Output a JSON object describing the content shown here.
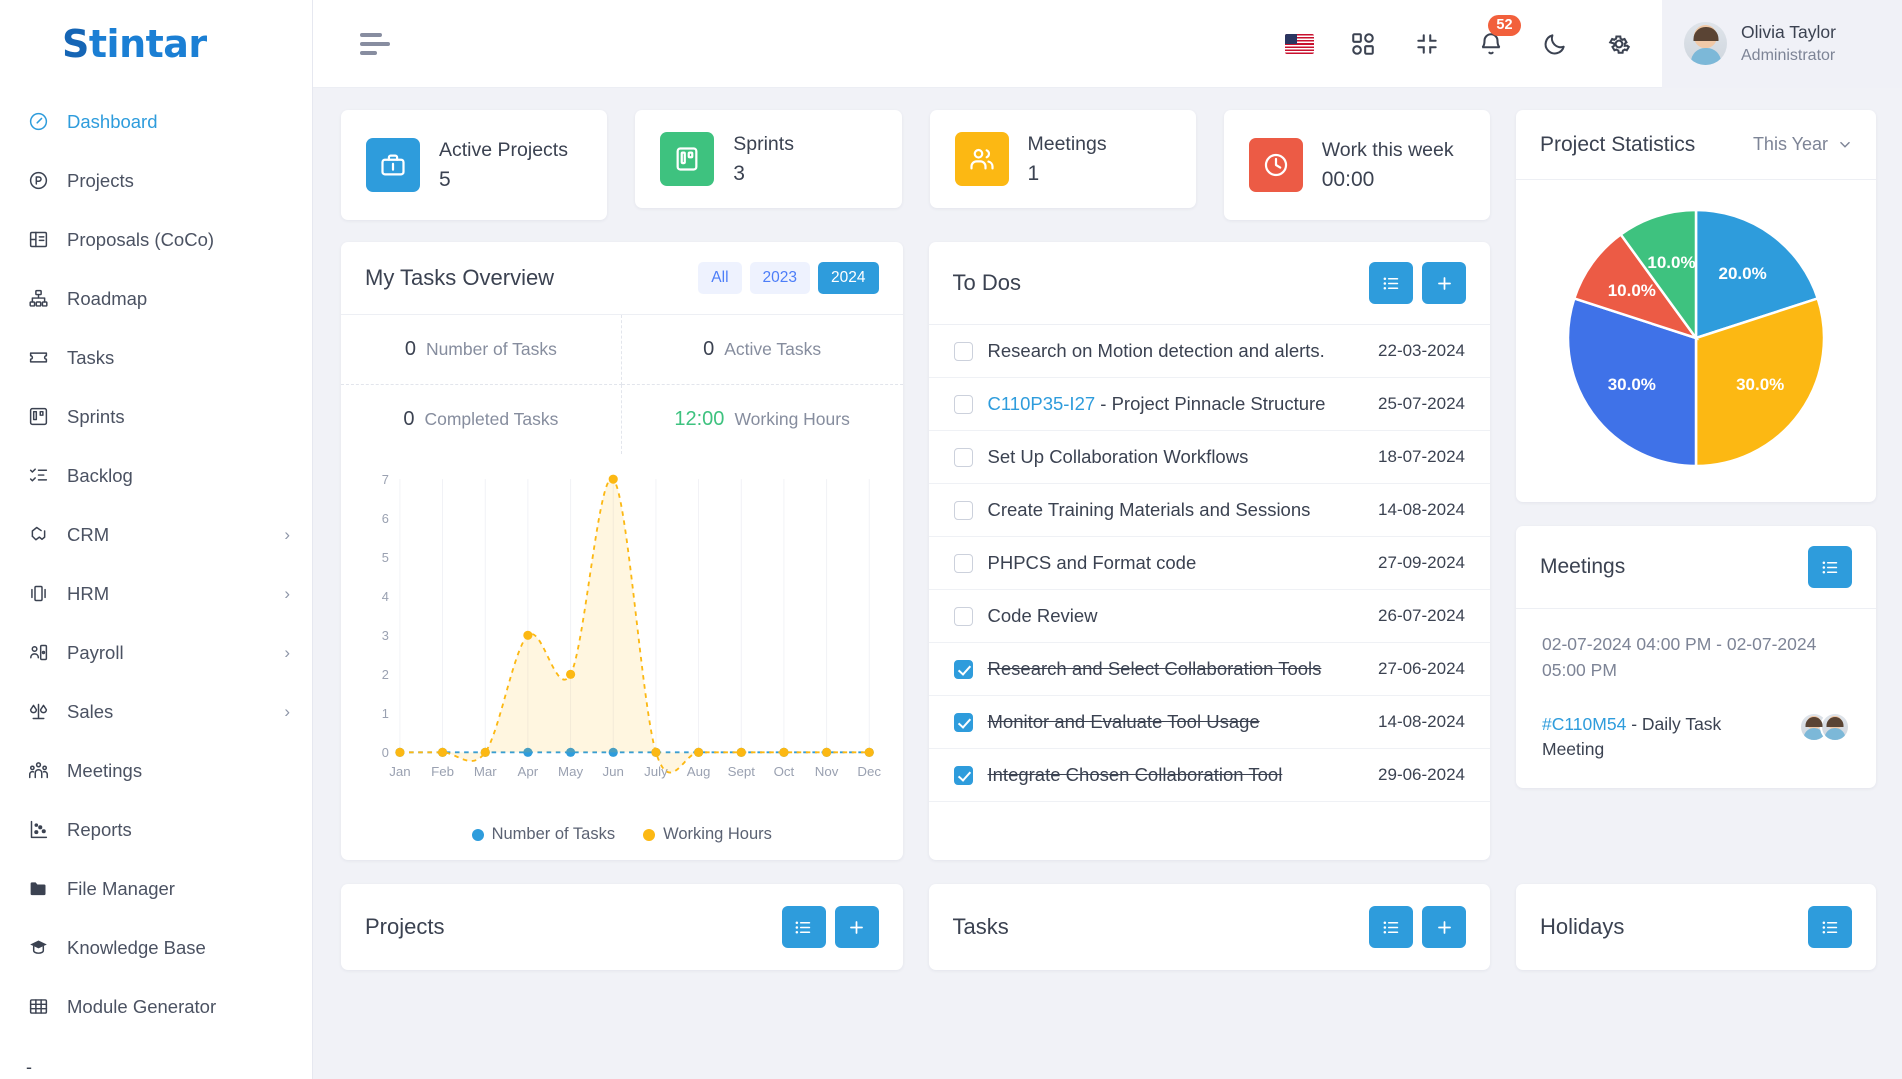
{
  "brand": {
    "name": "Stintar",
    "initial": "S",
    "rest": "tintar"
  },
  "colors": {
    "primary": "#2e9cdc",
    "sidebar_active": "#2e9cdc",
    "badge": "#f2603c",
    "green": "#3ec27f",
    "yellow": "#fcb813",
    "red": "#ec5b45",
    "royal_blue": "#3f72e8"
  },
  "sidebar": {
    "items": [
      {
        "label": "Dashboard",
        "icon": "speedometer-icon",
        "active": true,
        "chevron": false
      },
      {
        "label": "Projects",
        "icon": "circle-p-icon",
        "active": false,
        "chevron": false
      },
      {
        "label": "Proposals (CoCo)",
        "icon": "layout-panel-icon",
        "active": false,
        "chevron": false
      },
      {
        "label": "Roadmap",
        "icon": "hierarchy-icon",
        "active": false,
        "chevron": false
      },
      {
        "label": "Tasks",
        "icon": "ticket-icon",
        "active": false,
        "chevron": false
      },
      {
        "label": "Sprints",
        "icon": "kanban-board-icon",
        "active": false,
        "chevron": false
      },
      {
        "label": "Backlog",
        "icon": "checklist-icon",
        "active": false,
        "chevron": false
      },
      {
        "label": "CRM",
        "icon": "handshake-icon",
        "active": false,
        "chevron": true
      },
      {
        "label": "HRM",
        "icon": "carousel-icon",
        "active": false,
        "chevron": true
      },
      {
        "label": "Payroll",
        "icon": "user-card-icon",
        "active": false,
        "chevron": true
      },
      {
        "label": "Sales",
        "icon": "scales-icon",
        "active": false,
        "chevron": true
      },
      {
        "label": "Meetings",
        "icon": "people-group-icon",
        "active": false,
        "chevron": false
      },
      {
        "label": "Reports",
        "icon": "scatter-chart-icon",
        "active": false,
        "chevron": false
      },
      {
        "label": "File Manager",
        "icon": "folder-icon",
        "active": false,
        "chevron": false
      },
      {
        "label": "Knowledge Base",
        "icon": "graduation-cap-icon",
        "active": false,
        "chevron": false
      },
      {
        "label": "Module Generator",
        "icon": "grid-table-icon",
        "active": false,
        "chevron": false
      }
    ],
    "tail": "-"
  },
  "topbar": {
    "menu_toggle": "hamburger-menu-icon",
    "icons": [
      {
        "name": "flag-us-icon"
      },
      {
        "name": "apps-grid-icon"
      },
      {
        "name": "collapse-fullscreen-icon"
      },
      {
        "name": "notification-bell-icon",
        "badge": "52"
      },
      {
        "name": "dark-mode-moon-icon"
      },
      {
        "name": "settings-gear-icon"
      }
    ],
    "profile": {
      "name": "Olivia Taylor",
      "role": "Administrator",
      "avatar": "user-avatar"
    }
  },
  "stats": [
    {
      "title": "Active Projects",
      "value": "5",
      "icon": "briefcase-icon",
      "color": "#2e9cdc"
    },
    {
      "title": "Sprints",
      "value": "3",
      "icon": "board-icon",
      "color": "#3ec27f"
    },
    {
      "title": "Meetings",
      "value": "1",
      "icon": "users-icon",
      "color": "#fcb813"
    },
    {
      "title": "Work this week",
      "value": "00:00",
      "icon": "clock-icon",
      "color": "#ec5b45"
    }
  ],
  "tasks_overview": {
    "title": "My Tasks Overview",
    "filters": [
      {
        "label": "All",
        "active": false
      },
      {
        "label": "2023",
        "active": false
      },
      {
        "label": "2024",
        "active": true
      }
    ],
    "cells": [
      {
        "value": "0",
        "label": "Number of Tasks",
        "green": false
      },
      {
        "value": "0",
        "label": "Active Tasks",
        "green": false
      },
      {
        "value": "0",
        "label": "Completed Tasks",
        "green": false
      },
      {
        "value": "12:00",
        "label": "Working Hours",
        "green": true
      }
    ]
  },
  "chart_data": {
    "type": "area",
    "title": "My Tasks Overview",
    "xlabel": "",
    "ylabel": "",
    "ylim": [
      0,
      7
    ],
    "yticks": [
      0,
      1,
      2,
      3,
      4,
      5,
      6,
      7
    ],
    "grid": true,
    "legend_position": "bottom",
    "categories": [
      "Jan",
      "Feb",
      "Mar",
      "Apr",
      "May",
      "Jun",
      "July",
      "Aug",
      "Sept",
      "Oct",
      "Nov",
      "Dec"
    ],
    "series": [
      {
        "name": "Number of Tasks",
        "color": "#2e9cdc",
        "values": [
          0,
          0,
          0,
          0,
          0,
          0,
          0,
          0,
          0,
          0,
          0,
          0
        ]
      },
      {
        "name": "Working Hours",
        "color": "#fcb813",
        "values": [
          0,
          0,
          0,
          3,
          2,
          7,
          0,
          0,
          0,
          0,
          0,
          0
        ]
      }
    ]
  },
  "project_statistics": {
    "title": "Project Statistics",
    "range": "This Year",
    "chart": {
      "type": "pie",
      "values": [
        20.0,
        30.0,
        30.0,
        10.0,
        10.0
      ],
      "labels": [
        "20.0%",
        "30.0%",
        "30.0%",
        "10.0%",
        "10.0%"
      ],
      "colors": [
        "#2e9cdc",
        "#fcb813",
        "#3f72e8",
        "#ec5b45",
        "#3ec27f"
      ]
    }
  },
  "todos": {
    "title": "To Dos",
    "buttons": [
      {
        "name": "list-view-button",
        "icon": "list-icon"
      },
      {
        "name": "add-todo-button",
        "icon": "plus-icon"
      }
    ],
    "items": [
      {
        "text": "Research on Motion detection and alerts.",
        "link": "",
        "date": "22-03-2024",
        "done": false
      },
      {
        "text": " - Project Pinnacle Structure",
        "link": "C110P35-I27",
        "date": "25-07-2024",
        "done": false
      },
      {
        "text": "Set Up Collaboration Workflows",
        "link": "",
        "date": "18-07-2024",
        "done": false
      },
      {
        "text": "Create Training Materials and Sessions",
        "link": "",
        "date": "14-08-2024",
        "done": false
      },
      {
        "text": "PHPCS and Format code",
        "link": "",
        "date": "27-09-2024",
        "done": false
      },
      {
        "text": "Code Review",
        "link": "",
        "date": "26-07-2024",
        "done": false
      },
      {
        "text": "Research and Select Collaboration Tools",
        "link": "",
        "date": "27-06-2024",
        "done": true
      },
      {
        "text": "Monitor and Evaluate Tool Usage",
        "link": "",
        "date": "14-08-2024",
        "done": true
      },
      {
        "text": "Integrate Chosen Collaboration Tool",
        "link": "",
        "date": "29-06-2024",
        "done": true
      }
    ]
  },
  "meetings": {
    "title": "Meetings",
    "button_icon": "list-icon",
    "time": "02-07-2024 04:00 PM - 02-07-2024 05:00 PM",
    "code": "#C110M54",
    "name": " - Daily Task Meeting"
  },
  "bottom": {
    "projects": {
      "title": "Projects",
      "list_icon": "list-icon",
      "add_icon": "plus-icon"
    },
    "tasks": {
      "title": "Tasks",
      "list_icon": "list-icon",
      "add_icon": "plus-icon"
    },
    "holidays": {
      "title": "Holidays",
      "list_icon": "list-icon"
    }
  }
}
